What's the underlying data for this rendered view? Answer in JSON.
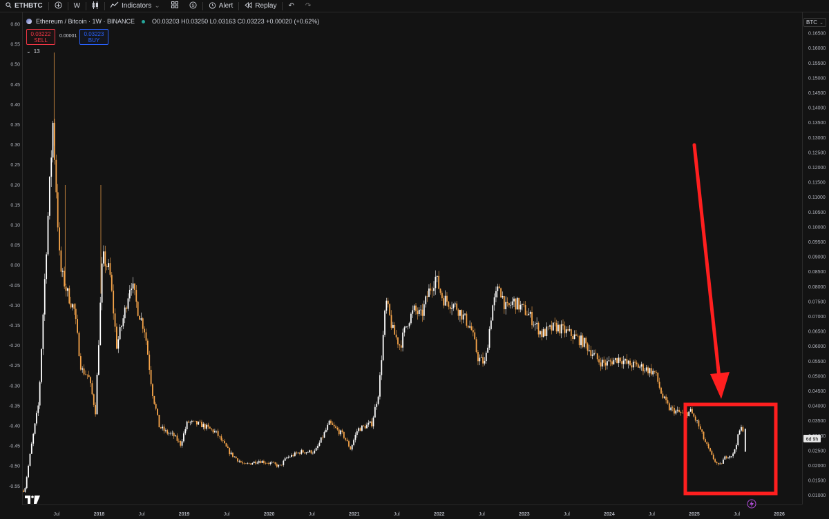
{
  "toolbar": {
    "symbol": "ETHBTC",
    "interval": "W",
    "indicators_label": "Indicators",
    "alert_label": "Alert",
    "replay_label": "Replay"
  },
  "legend": {
    "title": "Ethereum / Bitcoin · 1W · BINANCE",
    "ohlc": "O0.03203 H0.03250 L0.03163 C0.03223 +0.00020 (+0.62%)"
  },
  "trade": {
    "sell_price": "0.03222",
    "sell_label": "SELL",
    "spread": "0.00001",
    "buy_price": "0.03223",
    "buy_label": "BUY"
  },
  "collapse_count": "13",
  "right_scale_unit": "BTC",
  "countdown": "6d 9h",
  "colors": {
    "background": "#131313",
    "candle_up": "#ffffff",
    "candle_down": "#f7a54a",
    "annotation": "#ff1f1f"
  },
  "chart_data": {
    "type": "candlestick",
    "title": "Ethereum / Bitcoin · 1W · BINANCE",
    "right_axis": {
      "unit": "BTC",
      "range": [
        0.0075,
        0.1714
      ],
      "ticks": [
        "0.16500",
        "0.16000",
        "0.15500",
        "0.15000",
        "0.14500",
        "0.14000",
        "0.13500",
        "0.13000",
        "0.12500",
        "0.12000",
        "0.11500",
        "0.11000",
        "0.10500",
        "0.10000",
        "0.09500",
        "0.09000",
        "0.08500",
        "0.08000",
        "0.07500",
        "0.07000",
        "0.06500",
        "0.06000",
        "0.05500",
        "0.05000",
        "0.04500",
        "0.04000",
        "0.03500",
        "0.03000",
        "0.02500",
        "0.02000",
        "0.01500",
        "0.01000"
      ]
    },
    "left_axis": {
      "ticks": [
        "0.60",
        "0.55",
        "0.50",
        "0.45",
        "0.40",
        "0.35",
        "0.30",
        "0.25",
        "0.20",
        "0.15",
        "0.10",
        "0.05",
        "0.00",
        "-0.05",
        "-0.10",
        "-0.15",
        "-0.20",
        "-0.25",
        "-0.30",
        "-0.35",
        "-0.40",
        "-0.45",
        "-0.50",
        "-0.55"
      ]
    },
    "time_axis": {
      "labels": [
        "Jul",
        "2018",
        "Jul",
        "2019",
        "Jul",
        "2020",
        "Jul",
        "2021",
        "Jul",
        "2022",
        "Jul",
        "2023",
        "Jul",
        "2024",
        "Jul",
        "2025",
        "Jul",
        "2026"
      ]
    },
    "last_price": 0.03223,
    "close_series": [
      {
        "date": "2017-02",
        "close": 0.0115
      },
      {
        "date": "2017-03",
        "close": 0.027
      },
      {
        "date": "2017-04",
        "close": 0.041
      },
      {
        "date": "2017-05",
        "close": 0.09
      },
      {
        "date": "2017-06",
        "close": 0.135
      },
      {
        "date": "2017-07",
        "close": 0.086
      },
      {
        "date": "2017-08",
        "close": 0.078
      },
      {
        "date": "2017-09",
        "close": 0.072
      },
      {
        "date": "2017-10",
        "close": 0.052
      },
      {
        "date": "2017-11",
        "close": 0.05
      },
      {
        "date": "2017-12",
        "close": 0.038
      },
      {
        "date": "2018-01",
        "close": 0.09
      },
      {
        "date": "2018-02",
        "close": 0.085
      },
      {
        "date": "2018-03",
        "close": 0.06
      },
      {
        "date": "2018-04",
        "close": 0.07
      },
      {
        "date": "2018-05",
        "close": 0.082
      },
      {
        "date": "2018-06",
        "close": 0.072
      },
      {
        "date": "2018-07",
        "close": 0.065
      },
      {
        "date": "2018-08",
        "close": 0.045
      },
      {
        "date": "2018-09",
        "close": 0.033
      },
      {
        "date": "2018-10",
        "close": 0.031
      },
      {
        "date": "2018-11",
        "close": 0.03
      },
      {
        "date": "2018-12",
        "close": 0.027
      },
      {
        "date": "2019-01",
        "close": 0.0345
      },
      {
        "date": "2019-03",
        "close": 0.0335
      },
      {
        "date": "2019-05",
        "close": 0.031
      },
      {
        "date": "2019-07",
        "close": 0.024
      },
      {
        "date": "2019-09",
        "close": 0.02
      },
      {
        "date": "2019-11",
        "close": 0.0215
      },
      {
        "date": "2020-01",
        "close": 0.0205
      },
      {
        "date": "2020-02",
        "close": 0.0195
      },
      {
        "date": "2020-03",
        "close": 0.0225
      },
      {
        "date": "2020-05",
        "close": 0.0245
      },
      {
        "date": "2020-07",
        "close": 0.0245
      },
      {
        "date": "2020-09",
        "close": 0.034
      },
      {
        "date": "2020-11",
        "close": 0.03
      },
      {
        "date": "2020-12",
        "close": 0.0255
      },
      {
        "date": "2021-01",
        "close": 0.032
      },
      {
        "date": "2021-03",
        "close": 0.034
      },
      {
        "date": "2021-04",
        "close": 0.045
      },
      {
        "date": "2021-05",
        "close": 0.075
      },
      {
        "date": "2021-06",
        "close": 0.065
      },
      {
        "date": "2021-07",
        "close": 0.06
      },
      {
        "date": "2021-08",
        "close": 0.068
      },
      {
        "date": "2021-09",
        "close": 0.072
      },
      {
        "date": "2021-10",
        "close": 0.07
      },
      {
        "date": "2021-11",
        "close": 0.078
      },
      {
        "date": "2021-12",
        "close": 0.083
      },
      {
        "date": "2022-01",
        "close": 0.076
      },
      {
        "date": "2022-03",
        "close": 0.073
      },
      {
        "date": "2022-05",
        "close": 0.066
      },
      {
        "date": "2022-06",
        "close": 0.056
      },
      {
        "date": "2022-07",
        "close": 0.054
      },
      {
        "date": "2022-08",
        "close": 0.073
      },
      {
        "date": "2022-09",
        "close": 0.08
      },
      {
        "date": "2022-10",
        "close": 0.072
      },
      {
        "date": "2022-11",
        "close": 0.075
      },
      {
        "date": "2023-01",
        "close": 0.071
      },
      {
        "date": "2023-03",
        "close": 0.064
      },
      {
        "date": "2023-05",
        "close": 0.0665
      },
      {
        "date": "2023-07",
        "close": 0.064
      },
      {
        "date": "2023-09",
        "close": 0.061
      },
      {
        "date": "2023-11",
        "close": 0.055
      },
      {
        "date": "2023-12",
        "close": 0.054
      },
      {
        "date": "2024-02",
        "close": 0.056
      },
      {
        "date": "2024-03",
        "close": 0.054
      },
      {
        "date": "2024-05",
        "close": 0.053
      },
      {
        "date": "2024-07",
        "close": 0.051
      },
      {
        "date": "2024-08",
        "close": 0.043
      },
      {
        "date": "2024-09",
        "close": 0.039
      },
      {
        "date": "2024-10",
        "close": 0.038
      },
      {
        "date": "2024-11",
        "close": 0.037
      },
      {
        "date": "2024-12",
        "close": 0.038
      },
      {
        "date": "2025-01",
        "close": 0.034
      },
      {
        "date": "2025-02",
        "close": 0.028
      },
      {
        "date": "2025-03",
        "close": 0.023
      },
      {
        "date": "2025-04",
        "close": 0.0195
      },
      {
        "date": "2025-05",
        "close": 0.023
      },
      {
        "date": "2025-06",
        "close": 0.0235
      },
      {
        "date": "2025-07",
        "close": 0.0322
      }
    ]
  }
}
